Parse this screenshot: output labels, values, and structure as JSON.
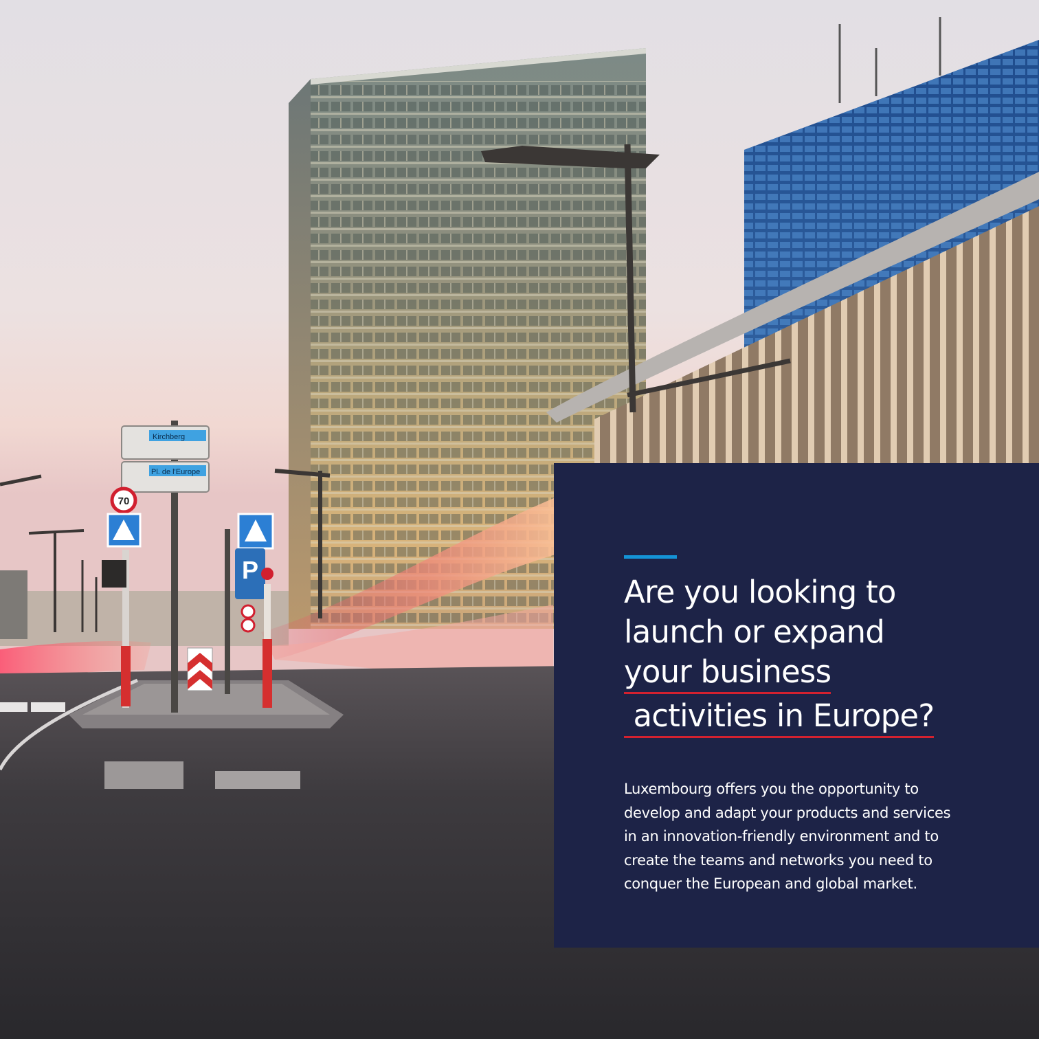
{
  "panel": {
    "headline": {
      "line1": "Are you looking to",
      "line2": "launch or expand",
      "line3": "your business",
      "line4": " activities in Europe?"
    },
    "body": "Luxembourg offers you the opportunity to develop and adapt your products and services in an innovation-friendly environment and to create the teams and networks you need to conquer the European and global market."
  },
  "colors": {
    "panel_background": "#1d2347",
    "accent_bar": "#1493d6",
    "underline": "#d3212f",
    "text": "#ffffff"
  },
  "photo": {
    "signs": {
      "top_sign_text": "Kirchberg",
      "bottom_sign_text": "Pl. de l'Europe",
      "speed_limit": "70",
      "parking_letter": "P"
    }
  }
}
